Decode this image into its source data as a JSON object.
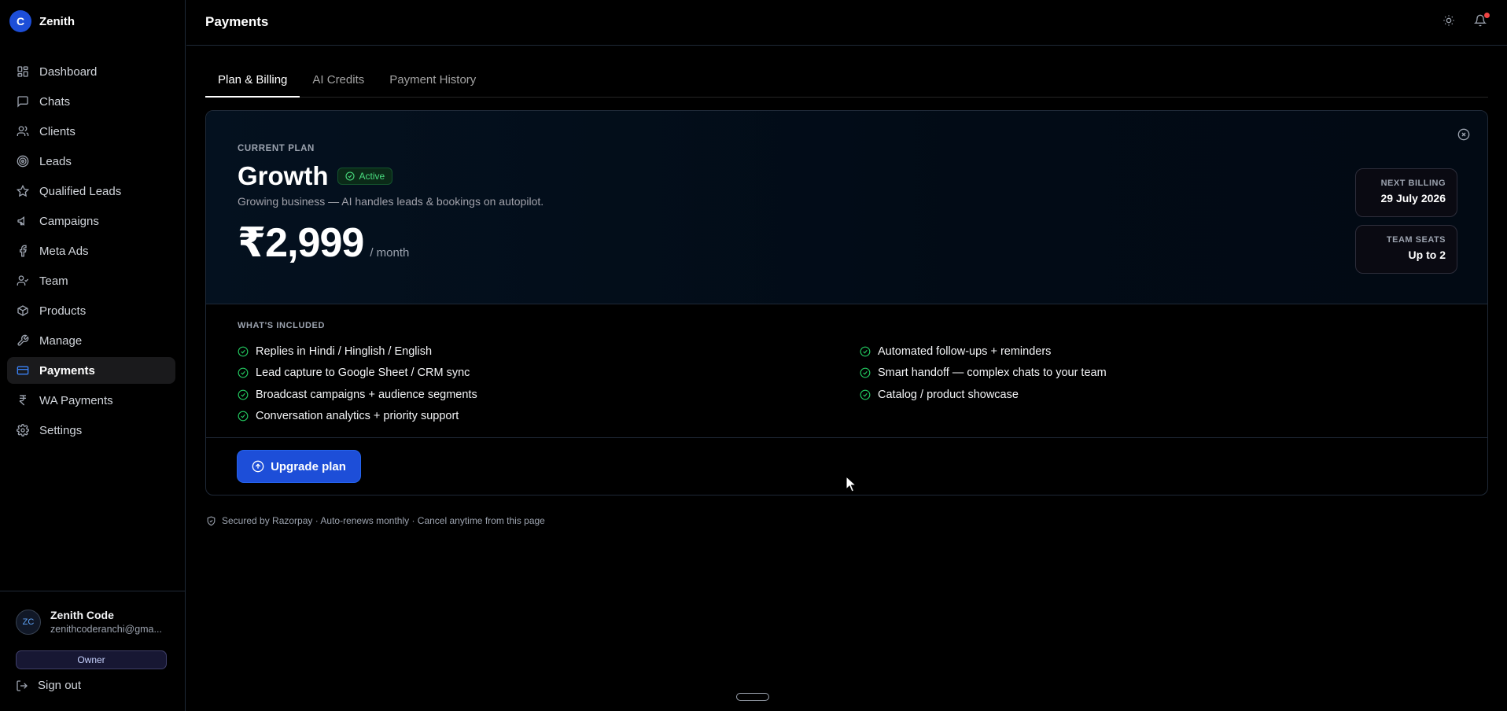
{
  "brand": {
    "logo_letter": "C",
    "name": "Zenith"
  },
  "sidebar": {
    "items": [
      {
        "label": "Dashboard",
        "icon": "grid-icon"
      },
      {
        "label": "Chats",
        "icon": "message-square-icon"
      },
      {
        "label": "Clients",
        "icon": "users-icon"
      },
      {
        "label": "Leads",
        "icon": "target-icon"
      },
      {
        "label": "Qualified Leads",
        "icon": "star-icon"
      },
      {
        "label": "Campaigns",
        "icon": "megaphone-icon"
      },
      {
        "label": "Meta Ads",
        "icon": "facebook-icon"
      },
      {
        "label": "Team",
        "icon": "user-check-icon"
      },
      {
        "label": "Products",
        "icon": "package-icon"
      },
      {
        "label": "Manage",
        "icon": "wrench-icon"
      },
      {
        "label": "Payments",
        "icon": "credit-card-icon",
        "active": true
      },
      {
        "label": "WA Payments",
        "icon": "rupee-icon"
      },
      {
        "label": "Settings",
        "icon": "gear-icon"
      }
    ],
    "user": {
      "initials": "ZC",
      "name": "Zenith Code",
      "email": "zenithcoderanchi@gma...",
      "role": "Owner"
    },
    "signout_label": "Sign out"
  },
  "header": {
    "title": "Payments"
  },
  "tabs": [
    {
      "label": "Plan & Billing",
      "active": true
    },
    {
      "label": "AI Credits"
    },
    {
      "label": "Payment History"
    }
  ],
  "plan": {
    "section_label": "CURRENT PLAN",
    "name": "Growth",
    "status": "Active",
    "description": "Growing business — AI handles leads & bookings on autopilot.",
    "price": "₹2,999",
    "period": "/ month",
    "next_billing_label": "NEXT BILLING",
    "next_billing_value": "29 July 2026",
    "team_seats_label": "TEAM SEATS",
    "team_seats_value": "Up to 2"
  },
  "features": {
    "label": "WHAT'S INCLUDED",
    "left": [
      "Replies in Hindi / Hinglish / English",
      "Lead capture to Google Sheet / CRM sync",
      "Broadcast campaigns + audience segments",
      "Conversation analytics + priority support"
    ],
    "right": [
      "Automated follow-ups + reminders",
      "Smart handoff — complex chats to your team",
      "Catalog / product showcase"
    ]
  },
  "actions": {
    "upgrade_label": "Upgrade plan"
  },
  "footer_note": "Secured by Razorpay · Auto-renews monthly · Cancel anytime from this page",
  "colors": {
    "accent": "#1d4ed8",
    "success": "#22c55e",
    "background": "#000000"
  }
}
